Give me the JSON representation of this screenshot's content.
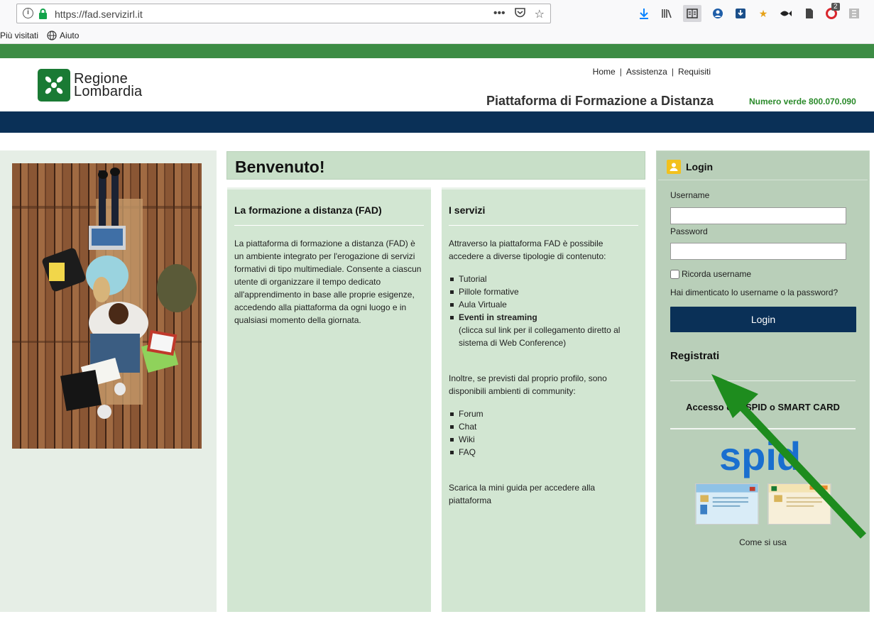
{
  "browser": {
    "url": "https://fad.servizirl.it",
    "bookmarks": [
      "Più visitati",
      "Aiuto"
    ],
    "badge_count": "2"
  },
  "header": {
    "logo_line1": "Regione",
    "logo_line2": "Lombardia",
    "nav": [
      "Home",
      "Assistenza",
      "Requisiti"
    ],
    "platform_title": "Piattaforma di Formazione a Distanza",
    "numero_verde": "Numero verde 800.070.090"
  },
  "colors": {
    "green_bar": "#3c8c44",
    "navy_bar": "#0a3057",
    "panel_green": "#d2e6d2",
    "login_green": "#b9cfb9",
    "arrow_green": "#1e8c1e"
  },
  "welcome_title": "Benvenuto!",
  "fad": {
    "title": "La formazione a distanza (FAD)",
    "body": "La piattaforma di formazione a distanza (FAD) è un ambiente integrato per l'erogazione di servizi formativi di tipo multimediale. Consente a ciascun utente di organizzare il tempo dedicato all'apprendimento in base alle proprie esigenze, accedendo alla piattaforma da ogni luogo e in qualsiasi momento della giornata."
  },
  "servizi": {
    "title": "I servizi",
    "intro": "Attraverso la piattaforma FAD è possibile accedere a diverse tipologie di contenuto:",
    "items": [
      "Tutorial",
      "Pillole formative",
      "Aula Virtuale",
      "Eventi in streaming"
    ],
    "streaming_note": "(clicca sul link per il collegamento diretto al sistema di Web Conference)",
    "community_intro": "Inoltre, se previsti dal proprio profilo, sono disponibili ambienti di community:",
    "community_items": [
      "Forum",
      "Chat",
      "Wiki",
      "FAQ"
    ],
    "guide": "Scarica la mini guida per accedere alla piattaforma"
  },
  "login": {
    "title": "Login",
    "username_label": "Username",
    "password_label": "Password",
    "username_value": "",
    "password_value": "",
    "remember_label": "Ricorda username",
    "forgot": "Hai dimenticato lo username o la password?",
    "button": "Login",
    "register": "Registrati",
    "spid_title": "Accesso con SPID o SMART CARD",
    "spid_logo": "spid",
    "come_si_usa": "Come si usa"
  }
}
